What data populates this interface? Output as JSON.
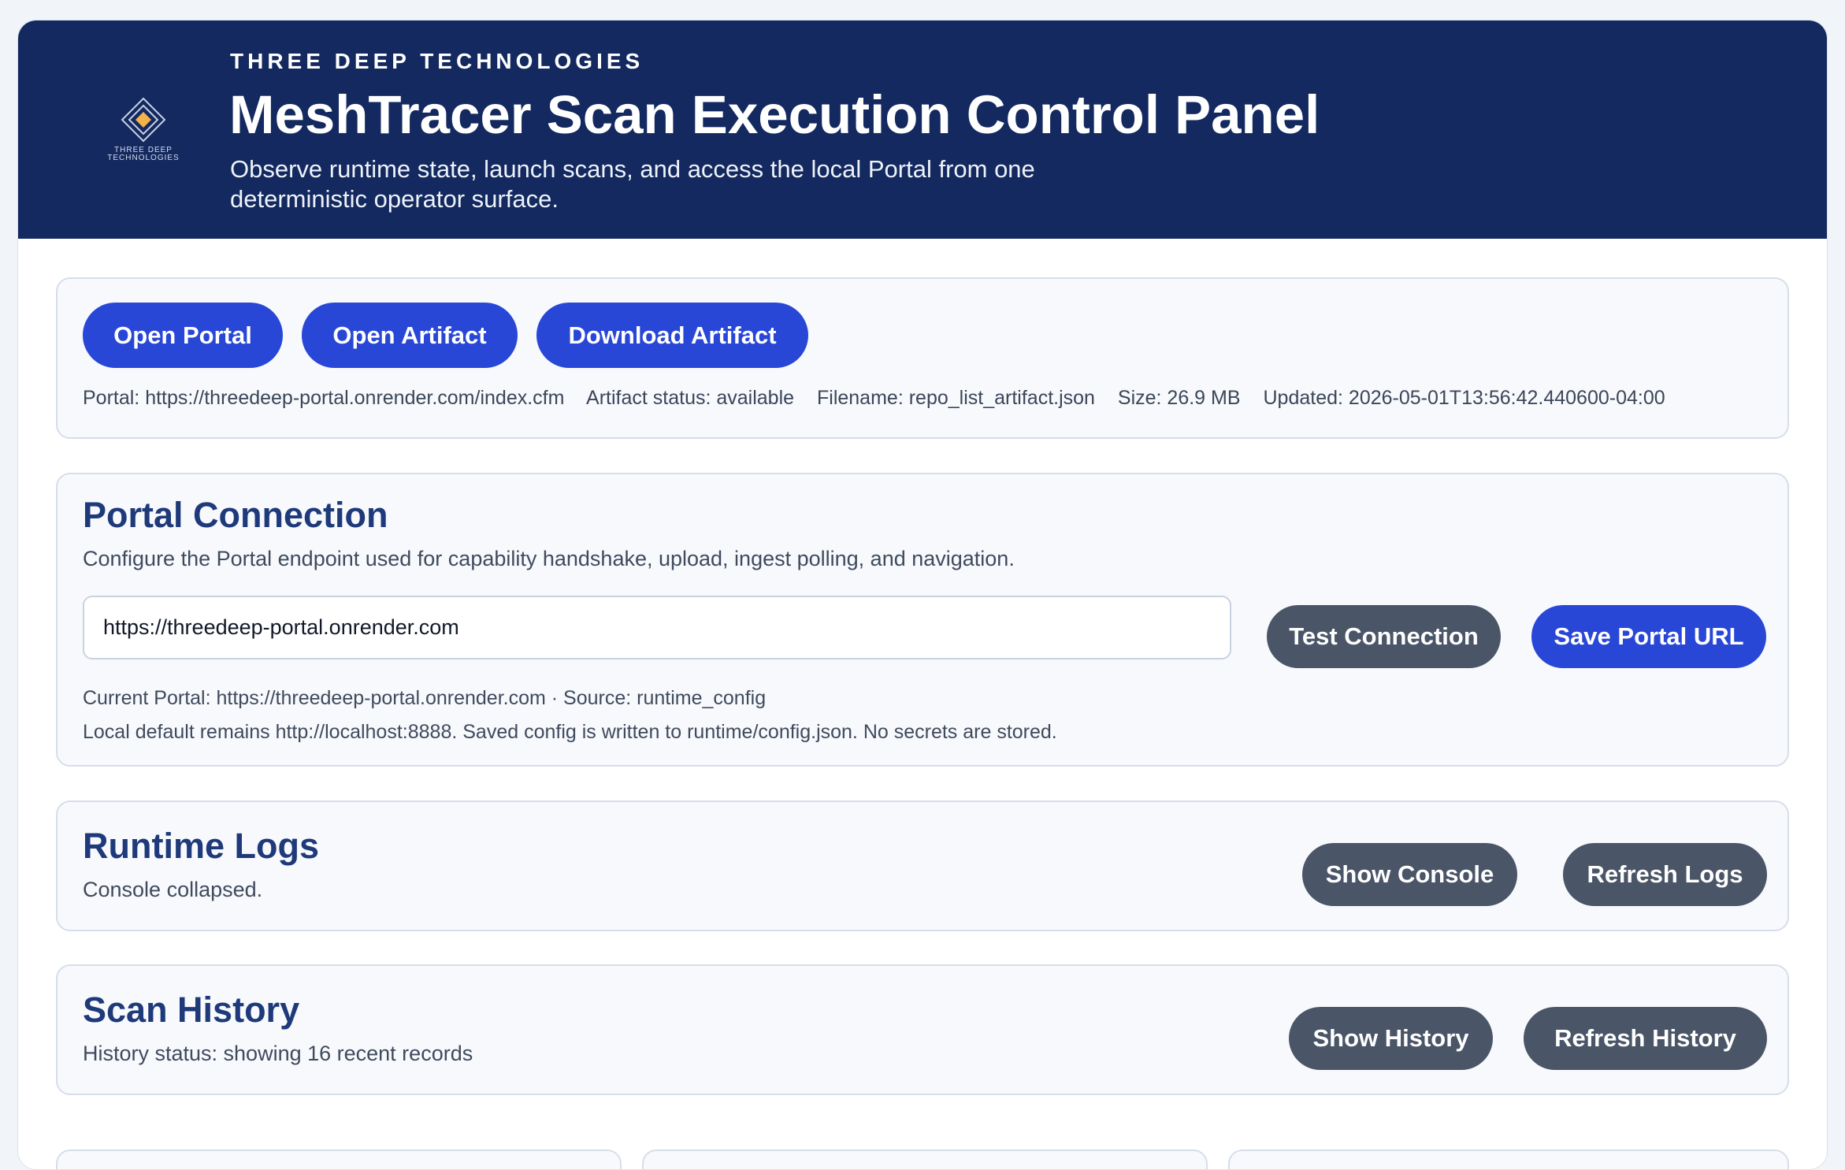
{
  "header": {
    "logo_text": "THREE DEEP TECHNOLOGIES",
    "eyebrow": "THREE DEEP TECHNOLOGIES",
    "title": "MeshTracer Scan Execution Control Panel",
    "subtitle": "Observe runtime state, launch scans, and access the local Portal from one deterministic operator surface.",
    "accent_color": "#f5b14a",
    "background_color": "#13295f"
  },
  "actions": {
    "open_portal_label": "Open Portal",
    "open_artifact_label": "Open Artifact",
    "download_artifact_label": "Download Artifact",
    "meta": {
      "portal": "Portal: https://threedeep-portal.onrender.com/index.cfm",
      "artifact_status": "Artifact status: available",
      "filename": "Filename: repo_list_artifact.json",
      "size": "Size: 26.9 MB",
      "updated": "Updated: 2026-05-01T13:56:42.440600-04:00"
    }
  },
  "portal_connection": {
    "title": "Portal Connection",
    "description": "Configure the Portal endpoint used for capability handshake, upload, ingest polling, and navigation.",
    "url_value": "https://threedeep-portal.onrender.com",
    "test_label": "Test Connection",
    "save_label": "Save Portal URL",
    "current": "Current Portal: https://threedeep-portal.onrender.com · Source: runtime_config",
    "note": "Local default remains http://localhost:8888. Saved config is written to runtime/config.json. No secrets are stored."
  },
  "runtime_logs": {
    "title": "Runtime Logs",
    "status": "Console collapsed.",
    "show_label": "Show Console",
    "refresh_label": "Refresh Logs"
  },
  "scan_history": {
    "title": "Scan History",
    "status": "History status: showing 16 recent records",
    "show_label": "Show History",
    "refresh_label": "Refresh History"
  },
  "colors": {
    "primary_button": "#2947d6",
    "secondary_button": "#4a5567",
    "section_title": "#1f3a7a"
  }
}
